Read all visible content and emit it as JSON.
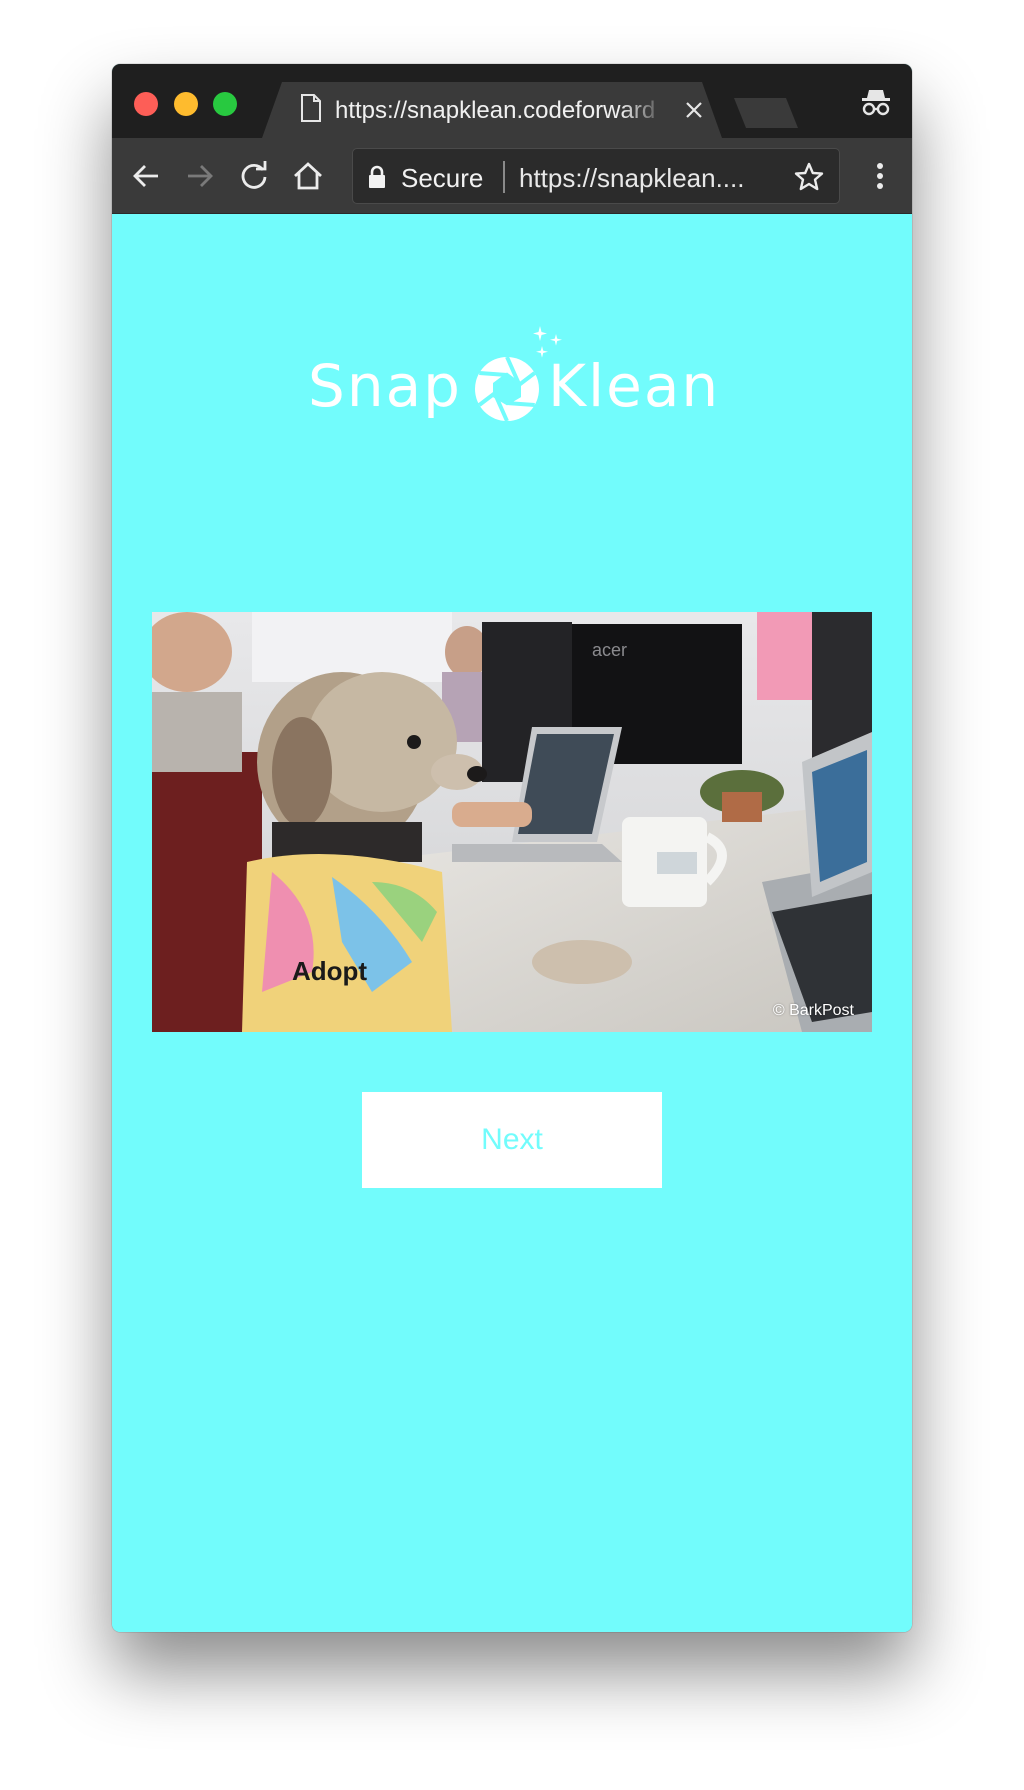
{
  "browser": {
    "tab": {
      "title": "https://snapklean.codeforward"
    },
    "toolbar": {
      "secure_label": "Secure",
      "url": "https://snapklean...."
    }
  },
  "page": {
    "logo": {
      "left_text": "Snap",
      "right_text": "Klean"
    },
    "gif": {
      "credit": "© BarkPost"
    },
    "next_button_label": "Next"
  },
  "colors": {
    "background": "#72fcfc",
    "button_bg": "#ffffff",
    "button_text": "#72fcfc",
    "titlebar": "#1f1f1f",
    "toolbar": "#3a3a3a"
  },
  "icons": [
    "document-icon",
    "close-icon",
    "incognito-icon",
    "back-icon",
    "forward-icon",
    "reload-icon",
    "home-icon",
    "lock-icon",
    "star-icon",
    "menu-icon",
    "aperture-icon",
    "sparkles-icon"
  ]
}
